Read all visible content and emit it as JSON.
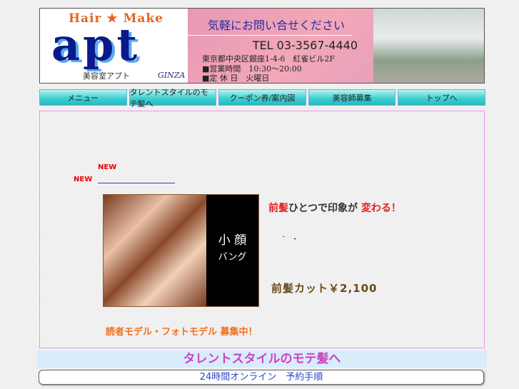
{
  "header": {
    "hair_make": "Hair ★ Make",
    "logo": "apt",
    "salon_name": "美容室アプト",
    "ginza": "GINZA",
    "contact": "気軽にお問い合せください",
    "tel": "TEL 03-3567-4440",
    "address": "東京都中央区銀座1-4-6　紅雀ビル2F",
    "hours": "■営業時間　10:30〜20:00",
    "holiday": "■定 休 日　火曜日"
  },
  "nav": [
    "メニュー",
    "タレントスタイルのモテ髪へ",
    "クーポン券/案内図",
    "美容師募集",
    "トップへ"
  ],
  "main": {
    "new1": "NEW",
    "new2": "NEW",
    "banner_title1": "小 顔",
    "banner_title2": "バング",
    "headline_red1": "前髪",
    "headline_mid": "ひとつで印象が",
    "headline_red2": "変わる！",
    "dots": "¨　・",
    "price": "前髪カット￥2,100",
    "recruit": "読者モデル・フォトモデル 募集中！"
  },
  "footer": {
    "talent": "タレントスタイルのモテ髪へ",
    "booking": "24時間オンライン　予約手順"
  }
}
